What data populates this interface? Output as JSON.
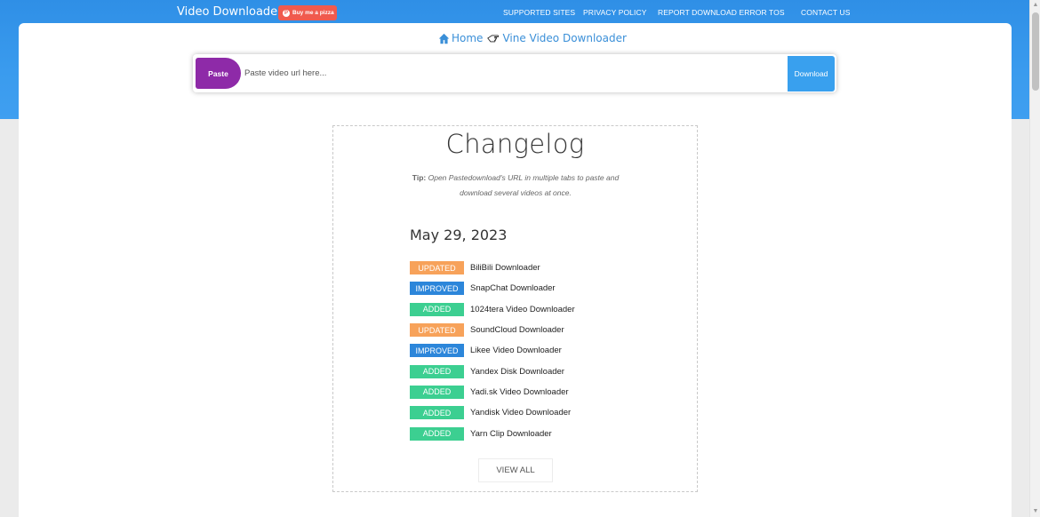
{
  "colors": {
    "header_blue": "#2f8fe6",
    "paste_purple": "#8e2aa8",
    "download_blue": "#39a0ee",
    "pizza_red": "#f05a4e",
    "updated_orange": "#f7a25a",
    "improved_blue": "#2c86da",
    "added_green": "#3ccf91",
    "link_blue": "#3a8fd8"
  },
  "header": {
    "brand": "Video Downloader",
    "pizza_button": "Buy me a pizza",
    "nav": [
      {
        "label": "SUPPORTED SITES"
      },
      {
        "label": "PRIVACY POLICY"
      },
      {
        "label": "REPORT DOWNLOAD ERROR"
      },
      {
        "label": "TOS"
      },
      {
        "label": "CONTACT US"
      }
    ]
  },
  "breadcrumb": {
    "home": "Home",
    "current": "Vine Video Downloader",
    "icons": [
      "home-icon",
      "pointing-hand-icon"
    ]
  },
  "search": {
    "paste_label": "Paste",
    "placeholder": "Paste video url here...",
    "value": "",
    "download_label": "Download"
  },
  "changelog": {
    "title": "Changelog",
    "tip_label": "Tip:",
    "tip_text": "Open Pastedownload's URL in multiple tabs to paste and download several videos at once.",
    "date": "May 29, 2023",
    "entries": [
      {
        "badge": "UPDATED",
        "kind": "updated",
        "text": "BiliBili Downloader"
      },
      {
        "badge": "IMPROVED",
        "kind": "improved",
        "text": "SnapChat Downloader"
      },
      {
        "badge": "ADDED",
        "kind": "added",
        "text": "1024tera Video Downloader"
      },
      {
        "badge": "UPDATED",
        "kind": "updated",
        "text": "SoundCloud Downloader"
      },
      {
        "badge": "IMPROVED",
        "kind": "improved",
        "text": "Likee Video Downloader"
      },
      {
        "badge": "ADDED",
        "kind": "added",
        "text": "Yandex Disk Downloader"
      },
      {
        "badge": "ADDED",
        "kind": "added",
        "text": "Yadi.sk Video Downloader"
      },
      {
        "badge": "ADDED",
        "kind": "added",
        "text": "Yandisk Video Downloader"
      },
      {
        "badge": "ADDED",
        "kind": "added",
        "text": "Yarn Clip Downloader"
      }
    ],
    "view_all": "VIEW ALL"
  }
}
